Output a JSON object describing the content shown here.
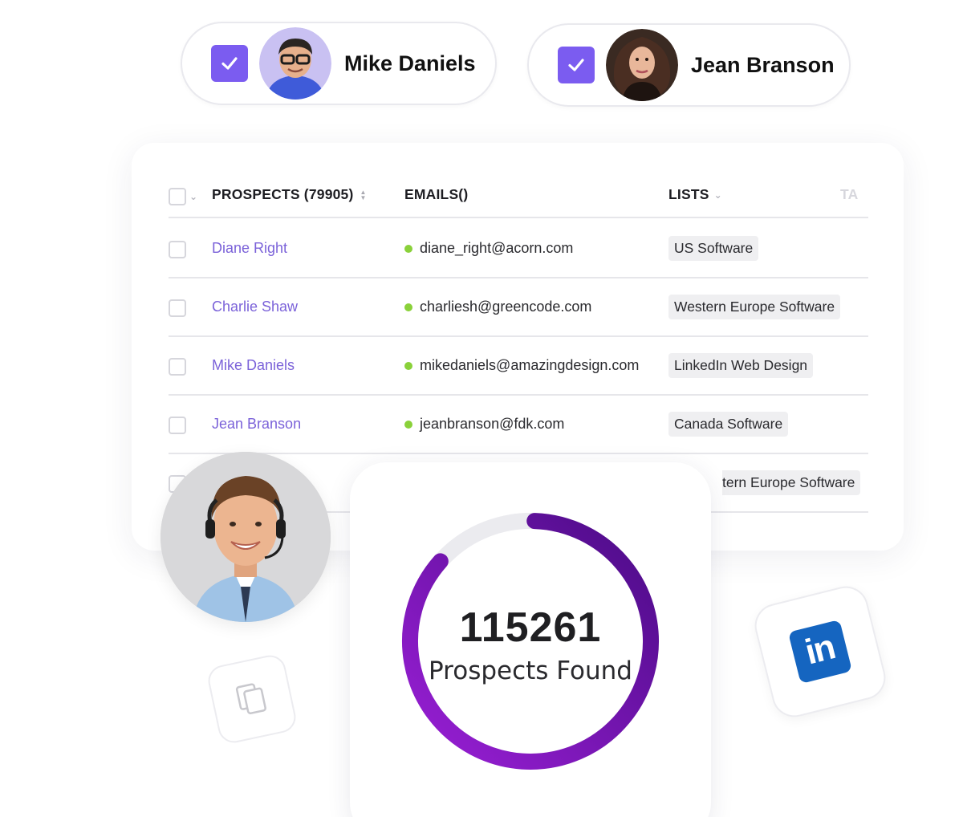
{
  "selected": [
    {
      "name": "Mike Daniels"
    },
    {
      "name": "Jean Branson"
    }
  ],
  "table": {
    "headers": {
      "prospects": "PROSPECTS (79905)",
      "emails": "EMAILS()",
      "lists": "LISTS",
      "tags": "TA"
    },
    "rows": [
      {
        "name": "Diane Right",
        "email": "diane_right@acorn.com",
        "list": "US Software"
      },
      {
        "name": "Charlie Shaw",
        "email": "charliesh@greencode.com",
        "list": "Western Europe Software"
      },
      {
        "name": "Mike Daniels",
        "email": "mikedaniels@amazingdesign.com",
        "list": "LinkedIn Web Design"
      },
      {
        "name": "Jean Branson",
        "email": "jeanbranson@fdk.com",
        "list": "Canada Software"
      },
      {
        "name": "",
        "email": "",
        "list": "tern Europe Software"
      }
    ]
  },
  "stats": {
    "count": "115261",
    "label": "Prospects Found",
    "progress": 0.86
  },
  "colors": {
    "accent": "#7b5cf0",
    "link": "#7b62d9",
    "status_dot": "#8ad13a",
    "ring_start": "#9a1fd6",
    "ring_end": "#4b0b86",
    "linkedin": "#1565c0"
  },
  "icons": [
    "check-icon",
    "chevron-down-icon",
    "sort-icon",
    "copy-icon",
    "linkedin-icon"
  ]
}
